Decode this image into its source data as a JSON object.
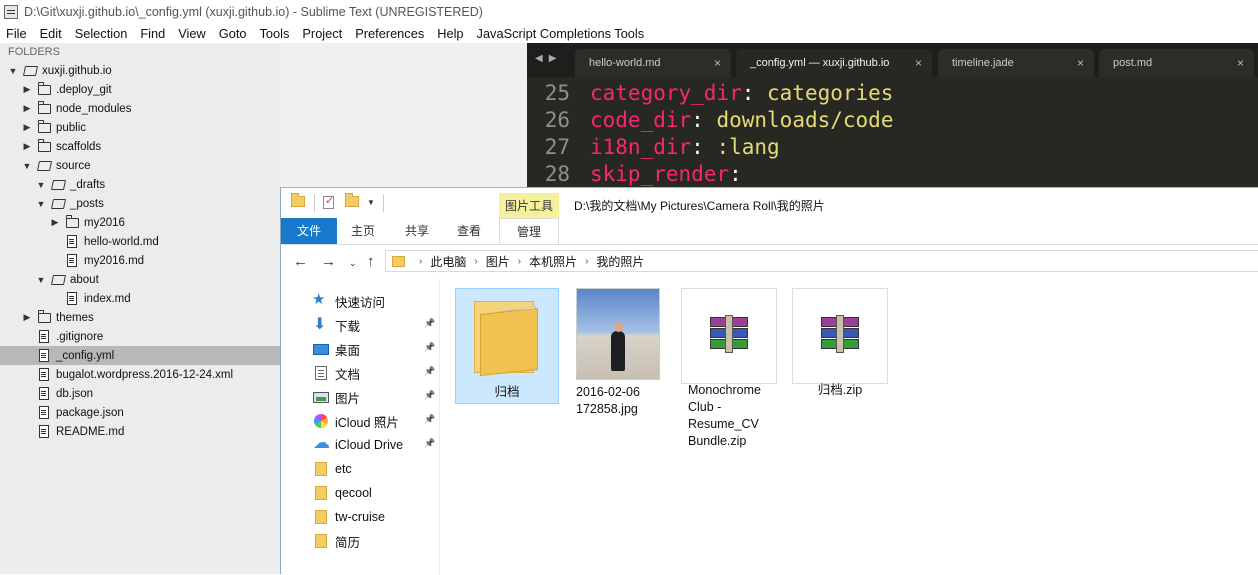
{
  "sublime": {
    "title": "D:\\Git\\xuxji.github.io\\_config.yml (xuxji.github.io) - Sublime Text (UNREGISTERED)",
    "menu": [
      "File",
      "Edit",
      "Selection",
      "Find",
      "View",
      "Goto",
      "Tools",
      "Project",
      "Preferences",
      "Help",
      "JavaScript Completions Tools"
    ],
    "sidebar_header": "FOLDERS",
    "tree": [
      {
        "label": "xuxji.github.io",
        "depth": 0,
        "type": "folder-open",
        "arrow": "down"
      },
      {
        "label": ".deploy_git",
        "depth": 1,
        "type": "folder",
        "arrow": "right"
      },
      {
        "label": "node_modules",
        "depth": 1,
        "type": "folder",
        "arrow": "right"
      },
      {
        "label": "public",
        "depth": 1,
        "type": "folder",
        "arrow": "right"
      },
      {
        "label": "scaffolds",
        "depth": 1,
        "type": "folder",
        "arrow": "right"
      },
      {
        "label": "source",
        "depth": 1,
        "type": "folder-open",
        "arrow": "down"
      },
      {
        "label": "_drafts",
        "depth": 2,
        "type": "folder-open",
        "arrow": "down"
      },
      {
        "label": "_posts",
        "depth": 2,
        "type": "folder-open",
        "arrow": "down"
      },
      {
        "label": "my2016",
        "depth": 3,
        "type": "folder",
        "arrow": "right"
      },
      {
        "label": "hello-world.md",
        "depth": 3,
        "type": "file",
        "arrow": ""
      },
      {
        "label": "my2016.md",
        "depth": 3,
        "type": "file",
        "arrow": ""
      },
      {
        "label": "about",
        "depth": 2,
        "type": "folder-open",
        "arrow": "down"
      },
      {
        "label": "index.md",
        "depth": 3,
        "type": "file",
        "arrow": ""
      },
      {
        "label": "themes",
        "depth": 1,
        "type": "folder",
        "arrow": "right"
      },
      {
        "label": ".gitignore",
        "depth": 1,
        "type": "file",
        "arrow": ""
      },
      {
        "label": "_config.yml",
        "depth": 1,
        "type": "file",
        "arrow": "",
        "selected": true
      },
      {
        "label": "bugalot.wordpress.2016-12-24.xml",
        "depth": 1,
        "type": "file",
        "arrow": ""
      },
      {
        "label": "db.json",
        "depth": 1,
        "type": "file",
        "arrow": ""
      },
      {
        "label": "package.json",
        "depth": 1,
        "type": "file",
        "arrow": ""
      },
      {
        "label": "README.md",
        "depth": 1,
        "type": "file",
        "arrow": ""
      }
    ],
    "tabs": [
      {
        "label": "hello-world.md",
        "active": false
      },
      {
        "label": "_config.yml — xuxji.github.io",
        "active": true
      },
      {
        "label": "timeline.jade",
        "active": false
      },
      {
        "label": "post.md",
        "active": false
      }
    ],
    "code": [
      {
        "num": "25",
        "key": "category_dir",
        "sep": ":",
        "val": " categories"
      },
      {
        "num": "26",
        "key": "code_dir",
        "sep": ":",
        "val": " downloads/code"
      },
      {
        "num": "27",
        "key": "i18n_dir",
        "sep": ":",
        "val": " :lang"
      },
      {
        "num": "28",
        "key": "skip_render",
        "sep": ":",
        "val": ""
      }
    ],
    "colors": {
      "editor_bg": "#272822",
      "keyword": "#f92672",
      "string": "#e6db74"
    }
  },
  "explorer": {
    "context_tab": "图片工具",
    "title_path": "D:\\我的文档\\My Pictures\\Camera Roll\\我的照片",
    "ribbon_tabs": [
      "文件",
      "主页",
      "共享",
      "查看",
      "管理"
    ],
    "breadcrumb": [
      "此电脑",
      "图片",
      "本机照片",
      "我的照片"
    ],
    "nav_items": [
      {
        "label": "快速访问",
        "icon": "star-icon",
        "pinned": false
      },
      {
        "label": "下载",
        "icon": "download-icon",
        "pinned": true
      },
      {
        "label": "桌面",
        "icon": "desktop-icon",
        "pinned": true
      },
      {
        "label": "文档",
        "icon": "document-icon",
        "pinned": true
      },
      {
        "label": "图片",
        "icon": "pictures-icon",
        "pinned": true
      },
      {
        "label": "iCloud 照片",
        "icon": "icloud-photos-icon",
        "pinned": true
      },
      {
        "label": "iCloud Drive",
        "icon": "icloud-drive-icon",
        "pinned": true
      },
      {
        "label": "etc",
        "icon": "folder-icon",
        "pinned": false
      },
      {
        "label": "qecool",
        "icon": "folder-icon",
        "pinned": false
      },
      {
        "label": "tw-cruise",
        "icon": "folder-icon",
        "pinned": false
      },
      {
        "label": "简历",
        "icon": "folder-icon",
        "pinned": false
      }
    ],
    "files": [
      {
        "label": "归档",
        "kind": "folder",
        "selected": true
      },
      {
        "label": "2016-02-06\n172858.jpg",
        "kind": "photo",
        "selected": false
      },
      {
        "label": "Monochrome\nClub -\nResume_CV\nBundle.zip",
        "kind": "zip",
        "selected": false
      },
      {
        "label": "归档.zip",
        "kind": "zip",
        "selected": false
      }
    ],
    "colors": {
      "file_tab": "#1979ca",
      "context_tab": "#f6ef9b",
      "selection": "#cce8ff"
    }
  }
}
